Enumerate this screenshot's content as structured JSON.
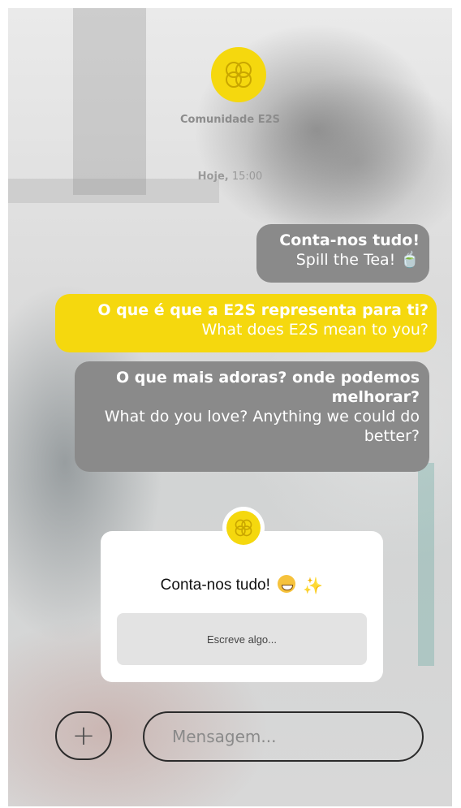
{
  "header": {
    "community_name": "Comunidade E2S",
    "timestamp_day": "Hoje,",
    "timestamp_time": "15:00",
    "logo_icon": "e2s-logo-icon"
  },
  "messages": [
    {
      "main": "Conta-nos tudo!",
      "sub": "Spill the Tea! 🍵"
    },
    {
      "main": "O que é que a E2S representa para ti?",
      "sub": "What does E2S mean to you?"
    },
    {
      "main": "O que mais adoras? onde podemos melhorar?",
      "sub": "What do you love? Anything we could do better?"
    }
  ],
  "question_card": {
    "title": "Conta-nos tudo!",
    "emoji_icons": [
      "grinning-face-icon",
      "sparkles-icon"
    ],
    "input_placeholder": "Escreve algo..."
  },
  "composer": {
    "add_icon": "plus-icon",
    "message_placeholder": "Mensagem..."
  },
  "colors": {
    "brand_yellow": "#f5d80e",
    "bubble_gray": "#8a8a8a",
    "text_white": "#ffffff"
  }
}
